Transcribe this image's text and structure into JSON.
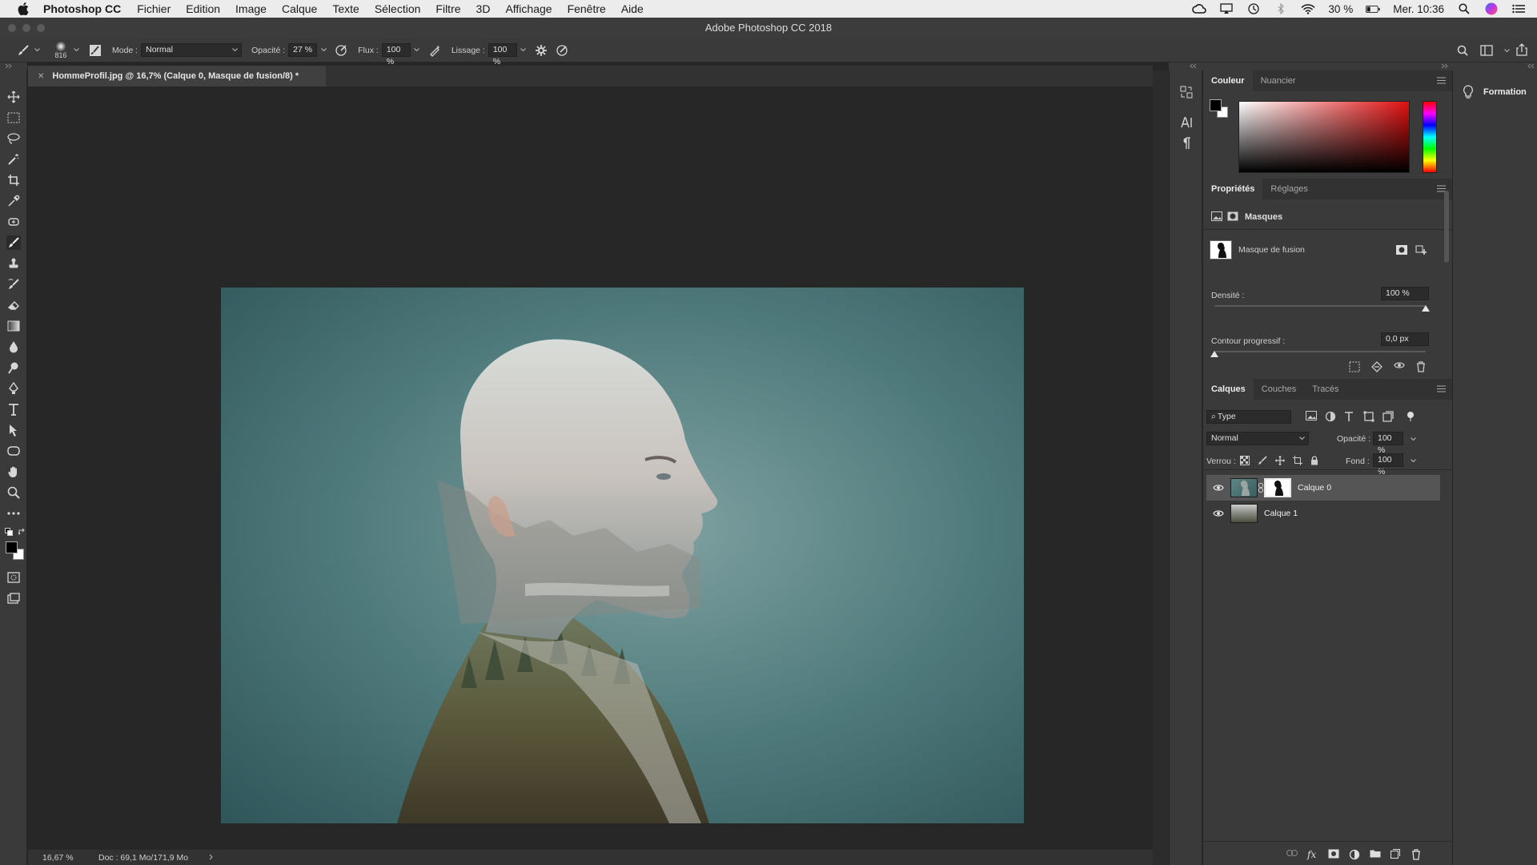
{
  "menubar": {
    "app_name": "Photoshop CC",
    "items": [
      "Fichier",
      "Edition",
      "Image",
      "Calque",
      "Texte",
      "Sélection",
      "Filtre",
      "3D",
      "Affichage",
      "Fenêtre",
      "Aide"
    ],
    "battery": "30 %",
    "clock": "Mer. 10:36"
  },
  "window": {
    "title": "Adobe Photoshop CC 2018"
  },
  "options": {
    "brush_size": "816",
    "mode_label": "Mode :",
    "mode_value": "Normal",
    "opacity_label": "Opacité :",
    "opacity_value": "27 %",
    "flow_label": "Flux :",
    "flow_value": "100 %",
    "smoothing_label": "Lissage :",
    "smoothing_value": "100 %"
  },
  "document": {
    "tab_title": "HommeProfil.jpg @ 16,7% (Calque 0, Masque de fusion/8) *",
    "zoom": "16,67 %",
    "doc_info": "Doc : 69,1 Mo/171,9 Mo"
  },
  "color_panel": {
    "tabs": [
      "Couleur",
      "Nuancier"
    ],
    "accent_hue": "#e01010"
  },
  "properties_panel": {
    "tabs": [
      "Propriétés",
      "Réglages"
    ],
    "section": "Masques",
    "mask_name": "Masque de fusion",
    "density_label": "Densité :",
    "density_value": "100 %",
    "density_level": 1.0,
    "feather_label": "Contour progressif :",
    "feather_value": "0,0 px",
    "feather_level": 0.0
  },
  "layers_panel": {
    "tabs": [
      "Calques",
      "Couches",
      "Tracés"
    ],
    "filter_value": "Type",
    "blend_mode": "Normal",
    "opacity_label": "Opacité :",
    "opacity_value": "100 %",
    "lock_label": "Verrou :",
    "fill_label": "Fond :",
    "fill_value": "100 %",
    "layers": [
      {
        "name": "Calque 0",
        "selected": true
      },
      {
        "name": "Calque 1",
        "selected": false
      }
    ]
  },
  "learn_panel": {
    "label": "Formation"
  }
}
